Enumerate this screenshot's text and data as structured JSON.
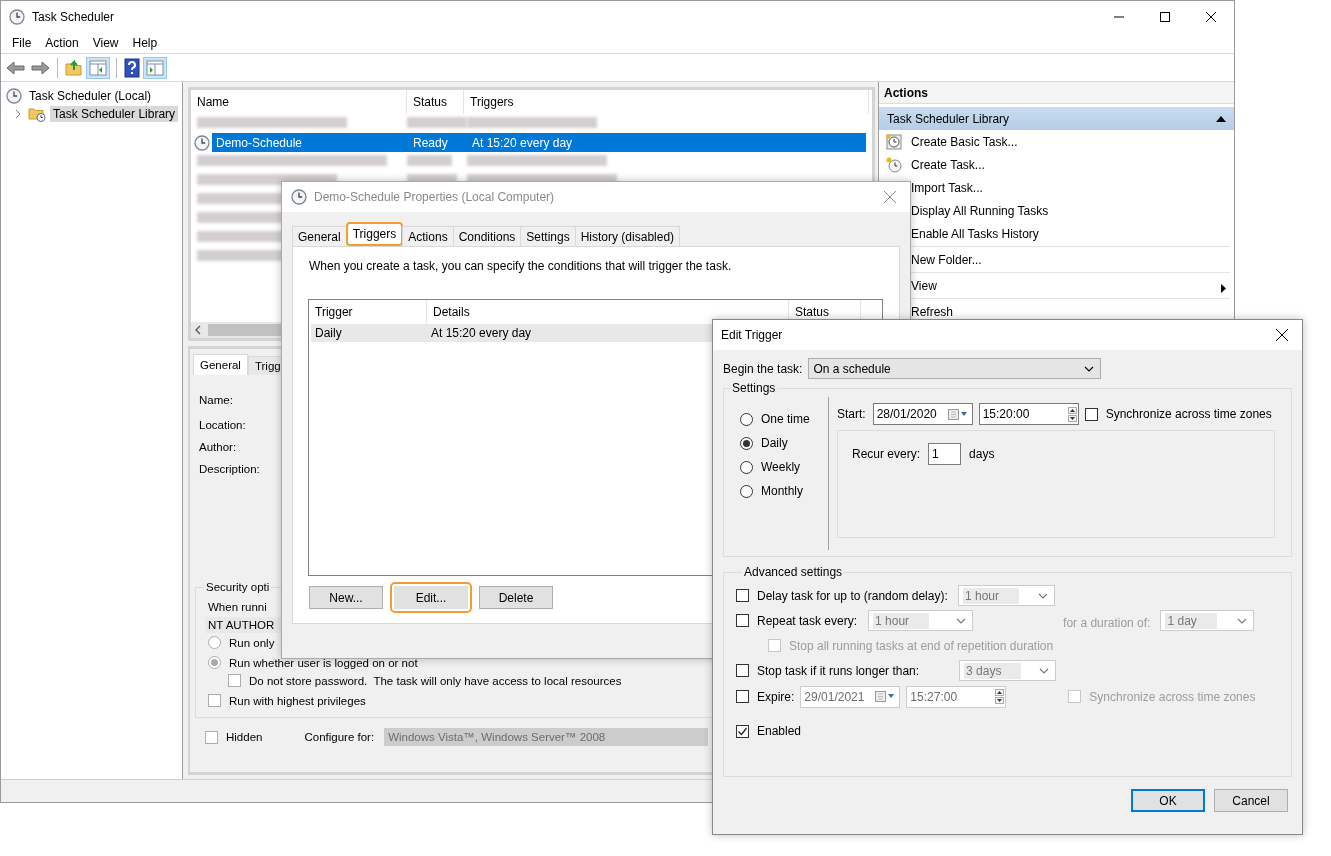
{
  "main_window": {
    "title": "Task Scheduler",
    "menu": [
      "File",
      "Action",
      "View",
      "Help"
    ]
  },
  "tree": [
    {
      "label": "Task Scheduler (Local)",
      "selected": false,
      "children": [
        {
          "label": "Task Scheduler Library",
          "selected": true,
          "expanded": false
        }
      ]
    }
  ],
  "task_list": {
    "columns": [
      "Name",
      "Status",
      "Triggers"
    ],
    "rows": [
      {
        "kind": "blurred",
        "selected": false
      },
      {
        "kind": "task",
        "name": "Demo-Schedule",
        "status": "Ready",
        "triggers": "At 15:20 every day",
        "selected": true
      },
      {
        "kind": "blurred",
        "selected": false
      },
      {
        "kind": "blurred",
        "selected": false
      },
      {
        "kind": "blurred",
        "selected": false
      },
      {
        "kind": "blurred",
        "selected": false
      },
      {
        "kind": "blurred",
        "selected": false
      },
      {
        "kind": "blurred",
        "selected": false
      }
    ]
  },
  "details": {
    "tabs": [
      {
        "label": "General",
        "selected": true
      },
      {
        "label": "Trigg",
        "selected": false
      }
    ],
    "fields": [
      "Name:",
      "Location:",
      "Author:",
      "Description:"
    ],
    "security": {
      "legend": "Security opti",
      "account_label": "When runni",
      "account": "NT AUTHOR",
      "options": [
        {
          "kind": "radio",
          "label": "Run only",
          "checked": false
        },
        {
          "kind": "radio",
          "label": "Run whether user is logged on or not",
          "checked": true,
          "children": [
            {
              "kind": "checkbox",
              "label": "Do not store password.  The task will only have access to local resources",
              "checked": false
            }
          ]
        },
        {
          "kind": "checkbox",
          "label": "Run with highest privileges",
          "checked": false
        }
      ]
    },
    "hidden": {
      "label": "Hidden",
      "checked": false
    },
    "configure_label": "Configure for:",
    "configure_value": "Windows Vista™, Windows Server™ 2008"
  },
  "actions": {
    "title": "Actions",
    "section": {
      "label": "Task Scheduler Library",
      "expanded": true
    },
    "items": [
      {
        "kind": "action",
        "label": "Create Basic Task..."
      },
      {
        "kind": "action",
        "label": "Create Task..."
      },
      {
        "kind": "action",
        "label": "Import Task..."
      },
      {
        "kind": "action",
        "label": "Display All Running Tasks"
      },
      {
        "kind": "action",
        "label": "Enable All Tasks History"
      },
      {
        "kind": "separator"
      },
      {
        "kind": "action",
        "label": "New Folder..."
      },
      {
        "kind": "separator"
      },
      {
        "kind": "submenu",
        "label": "View"
      },
      {
        "kind": "separator"
      },
      {
        "kind": "action",
        "label": "Refresh"
      }
    ]
  },
  "properties": {
    "title": "Demo-Schedule Properties (Local Computer)",
    "tabs": [
      {
        "label": "General",
        "selected": false,
        "highlighted": false
      },
      {
        "label": "Triggers",
        "selected": true,
        "highlighted": true
      },
      {
        "label": "Actions",
        "selected": false,
        "highlighted": false
      },
      {
        "label": "Conditions",
        "selected": false,
        "highlighted": false
      },
      {
        "label": "Settings",
        "selected": false,
        "highlighted": false
      },
      {
        "label": "History (disabled)",
        "selected": false,
        "highlighted": false
      }
    ],
    "description": "When you create a task, you can specify the conditions that will trigger the task.",
    "table": {
      "columns": [
        "Trigger",
        "Details",
        "Status"
      ],
      "rows": [
        {
          "trigger": "Daily",
          "details": "At 15:20 every day",
          "selected": true
        }
      ]
    },
    "buttons": [
      {
        "label": "New...",
        "focused": false,
        "highlighted": false
      },
      {
        "label": "Edit...",
        "focused": true,
        "highlighted": true
      },
      {
        "label": "Delete",
        "focused": false,
        "highlighted": false
      }
    ]
  },
  "edit_trigger": {
    "title": "Edit Trigger",
    "begin_label": "Begin the task:",
    "begin_value": "On a schedule",
    "settings_legend": "Settings",
    "schedule_options": [
      {
        "label": "One time",
        "selected": false
      },
      {
        "label": "Daily",
        "selected": true
      },
      {
        "label": "Weekly",
        "selected": false
      },
      {
        "label": "Monthly",
        "selected": false
      }
    ],
    "start_label": "Start:",
    "start_date": "28/01/2020",
    "start_time": "15:20:00",
    "start_sync": {
      "label": "Synchronize across time zones",
      "checked": false
    },
    "recur_label": "Recur every:",
    "recur_value": "1",
    "recur_unit": "days",
    "advanced_legend": "Advanced settings",
    "delay": {
      "label": "Delay task for up to (random delay):",
      "checked": false,
      "value": "1 hour"
    },
    "repeat": {
      "label": "Repeat task every:",
      "checked": false,
      "value": "1 hour",
      "duration_label": "for a duration of:",
      "duration_value": "1 day"
    },
    "stop_all": {
      "label": "Stop all running tasks at end of repetition duration",
      "checked": false,
      "disabled": true
    },
    "stop_long": {
      "label": "Stop task if it runs longer than:",
      "checked": false,
      "value": "3 days"
    },
    "expire": {
      "label": "Expire:",
      "checked": false,
      "date": "29/01/2021",
      "time": "15:27:00"
    },
    "expire_sync": {
      "label": "Synchronize across time zones",
      "checked": false,
      "disabled": true
    },
    "enabled": {
      "label": "Enabled",
      "checked": true
    },
    "buttons": [
      {
        "label": "OK",
        "default": true
      },
      {
        "label": "Cancel",
        "default": false
      }
    ]
  }
}
